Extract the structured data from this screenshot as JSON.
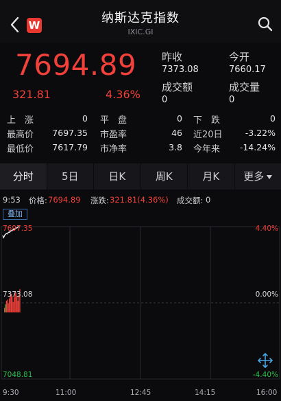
{
  "header": {
    "title": "纳斯达克指数",
    "subtitle": "IXIC.GI",
    "logo_letter": "W"
  },
  "quote": {
    "price": "7694.89",
    "change": "321.81",
    "change_pct": "4.36%",
    "prev_close_label": "昨收",
    "prev_close": "7373.08",
    "open_label": "今开",
    "open": "7660.17",
    "turnover_label": "成交额",
    "turnover": "0",
    "volume_label": "成交量",
    "volume": "0"
  },
  "stats": {
    "rows": [
      [
        {
          "label": "上　涨",
          "value": "0"
        },
        {
          "label": "平　盘",
          "value": "0"
        },
        {
          "label": "下　跌",
          "value": "0"
        }
      ],
      [
        {
          "label": "最高价",
          "value": "7697.35"
        },
        {
          "label": "市盈率",
          "value": "46"
        },
        {
          "label": "近20日",
          "value": "-3.22%"
        }
      ],
      [
        {
          "label": "最低价",
          "value": "7617.79"
        },
        {
          "label": "市净率",
          "value": "3.8"
        },
        {
          "label": "今年来",
          "value": "-14.24%"
        }
      ]
    ]
  },
  "tabs": [
    "分时",
    "5日",
    "日K",
    "周K",
    "月K",
    "更多"
  ],
  "info": {
    "time": "9:53",
    "price_label": "价格:",
    "price_value": "7694.89",
    "change_label": "涨跌:",
    "change_value": "321.81(4.36%)",
    "turnover_label": "成交额:",
    "turnover_value": "0"
  },
  "overlay_label": "叠加",
  "colors": {
    "up": "#f2413b",
    "down": "#2bc14b",
    "grid": "#2a2a2e"
  },
  "chart_data": {
    "type": "line",
    "y_left_ticks": [
      "7697.35",
      "7373.08",
      "7048.81"
    ],
    "y_right_ticks": [
      "4.40%",
      "0.00%",
      "-4.40%"
    ],
    "x_ticks": [
      "9:30",
      "11:00",
      "12:45",
      "14:15",
      "16:00"
    ],
    "ylim": [
      7048.81,
      7697.35
    ],
    "baseline": 7373.08,
    "price_line": {
      "x_minutes": [
        0,
        1,
        2,
        3,
        4,
        5,
        6,
        7,
        8,
        9,
        10,
        11,
        12,
        13,
        14,
        15,
        16,
        17,
        18,
        19,
        20,
        21,
        22,
        23
      ],
      "values": [
        7660.17,
        7650,
        7655,
        7662,
        7664,
        7668,
        7666,
        7670,
        7672,
        7675,
        7673,
        7678,
        7680,
        7679,
        7683,
        7686,
        7684,
        7688,
        7690,
        7692,
        7691,
        7694,
        7697,
        7694.89
      ]
    },
    "volume_bars": [
      0.2,
      0.35,
      0.5,
      0.55,
      0.4,
      0.6,
      0.75,
      0.8,
      0.7,
      0.45,
      0.65,
      0.9,
      0.85,
      0.7,
      0.5,
      0.75,
      1.0
    ],
    "volume_bar_colors": [
      "up",
      "down",
      "up",
      "up",
      "up",
      "up",
      "up",
      "up",
      "up",
      "up",
      "up",
      "up",
      "up",
      "up",
      "up",
      "up",
      "up"
    ]
  }
}
